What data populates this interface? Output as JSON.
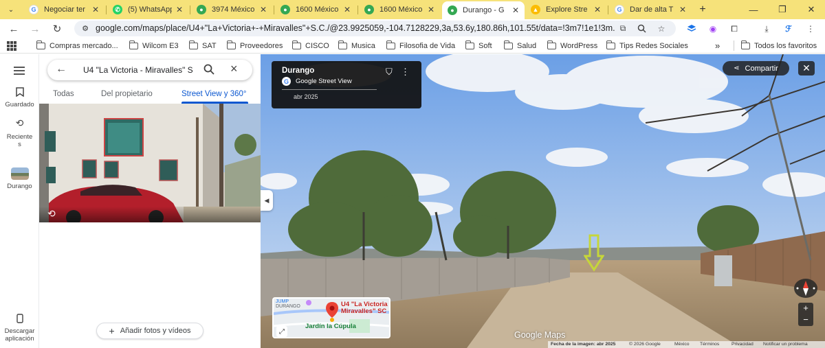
{
  "browser": {
    "tabs": [
      {
        "title": "Negociar ter",
        "favicon": "google-icon",
        "active": false
      },
      {
        "title": "(5) WhatsApp",
        "favicon": "whatsapp-icon",
        "active": false
      },
      {
        "title": "3974 México",
        "favicon": "maps-icon",
        "active": false
      },
      {
        "title": "1600 México",
        "favicon": "maps-icon",
        "active": false
      },
      {
        "title": "1600 México",
        "favicon": "maps-icon",
        "active": false
      },
      {
        "title": "Durango - G",
        "favicon": "maps-icon",
        "active": true
      },
      {
        "title": "Explore Stre",
        "favicon": "drive-icon",
        "active": false
      },
      {
        "title": "Dar de alta T",
        "favicon": "google-icon",
        "active": false
      }
    ],
    "new_tab": "+",
    "window_controls": {
      "minimize": "—",
      "restore": "❐",
      "close": "✕"
    },
    "url": "google.com/maps/place/U4+\"La+Victoria+-+Miravalles\"+S.C./@23.9925059,-104.7128229,3a,53.6y,180.86h,101.55t/data=!3m7!1e1!3m...",
    "bookmarks": [
      {
        "label": "Compras mercado..."
      },
      {
        "label": "Wilcom E3"
      },
      {
        "label": "SAT"
      },
      {
        "label": "Proveedores"
      },
      {
        "label": "CISCO"
      },
      {
        "label": "Musica"
      },
      {
        "label": "Filosofia de Vida"
      },
      {
        "label": "Soft"
      },
      {
        "label": "Salud"
      },
      {
        "label": "WordPress"
      },
      {
        "label": "Tips Redes Sociales"
      }
    ],
    "bookmarks_overflow": "»",
    "all_bookmarks": "Todos los favoritos"
  },
  "maps": {
    "rail": {
      "saved": "Guardado",
      "recent_line1": "Reciente",
      "recent_line2": "s",
      "recent_place": "Durango",
      "download_line1": "Descargar",
      "download_line2": "aplicación"
    },
    "search": {
      "value": "U4 \"La Victoria - Miravalles\" S"
    },
    "tabs": [
      {
        "label": "Todas"
      },
      {
        "label": "Del propietario"
      },
      {
        "label": "Street View y 360°"
      }
    ],
    "add_photos": "Añadir fotos y vídeos"
  },
  "streetview": {
    "place": "Durango",
    "provider": "Google Street View",
    "date": "abr 2025",
    "share": "Compartir",
    "minimap": {
      "place_label": "U4 \"La Victoria - Miravalles\" SC",
      "park": "Jardín la Cúpula",
      "top_label": "JUMP",
      "city_label": "DURANGO"
    },
    "logo": "Google Maps",
    "footer": {
      "capture": "Fecha de la imagen: abr 2025",
      "copyright": "© 2026 Google",
      "region": "México",
      "terms": "Términos",
      "privacy": "Privacidad",
      "report": "Notificar un problema"
    },
    "zoom_in": "+",
    "zoom_out": "−"
  },
  "colors": {
    "tabstrip": "#f6e27a",
    "accent": "#0b57d0",
    "sky": "#8fb6ea",
    "annotation_arrow": "#c6d63a"
  }
}
